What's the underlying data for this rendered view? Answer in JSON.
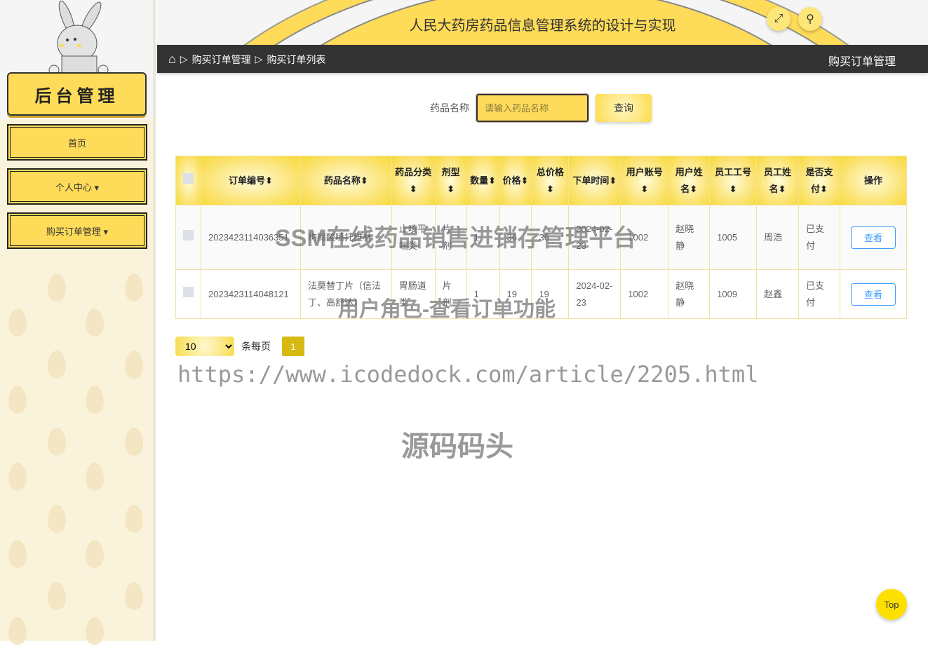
{
  "sidebar": {
    "logo_text": "后台管理",
    "items": [
      {
        "label": "首页"
      },
      {
        "label": "个人中心 ▾"
      },
      {
        "label": "购买订单管理 ▾"
      }
    ]
  },
  "header": {
    "title": "人民大药房药品信息管理系统的设计与实现",
    "fullscreen_icon": "expand-icon",
    "user_icon": "user-icon"
  },
  "breadcrumb": {
    "home_icon": "home-icon",
    "items": [
      "购买订单管理",
      "购买订单列表"
    ],
    "current": "购买订单管理"
  },
  "search": {
    "label": "药品名称",
    "placeholder": "请输入药品名称",
    "button": "查询"
  },
  "table": {
    "headers": [
      "订单编号⬍",
      "药品名称⬍",
      "药品分类⬍",
      "剂型⬍",
      "数量⬍",
      "价格⬍",
      "总价格⬍",
      "下单时间⬍",
      "用户账号⬍",
      "用户姓名⬍",
      "员工工号⬍",
      "员工姓名⬍",
      "是否支付⬍",
      "操作"
    ],
    "rows": [
      [
        "2023423114036351",
        "枸橼酸喷托维林",
        "止咳平喘类",
        "片剂",
        "1",
        "36",
        "36",
        "2024-02-23",
        "1002",
        "赵晓静",
        "1005",
        "周浩",
        "已支付",
        "查看"
      ],
      [
        "2023423114048121",
        "法莫替丁片（信法丁、高舒达）",
        "胃肠道类",
        "片剂",
        "1",
        "19",
        "19",
        "2024-02-23",
        "1002",
        "赵晓静",
        "1009",
        "赵鑫",
        "已支付",
        "查看"
      ]
    ]
  },
  "pagination": {
    "page_size": "10",
    "per_page_label": "条每页",
    "current_page": "1"
  },
  "watermarks": [
    "SSM在线药品销售进销存管理平台",
    "用户角色-查看订单功能",
    "https://www.icodedock.com/article/2205.html",
    "源码码头"
  ],
  "back_to_top": "Top",
  "colors": {
    "accent": "#fedb58",
    "dark_bar": "#333333",
    "view_button": "#409eff",
    "page_active": "#d8b912"
  }
}
